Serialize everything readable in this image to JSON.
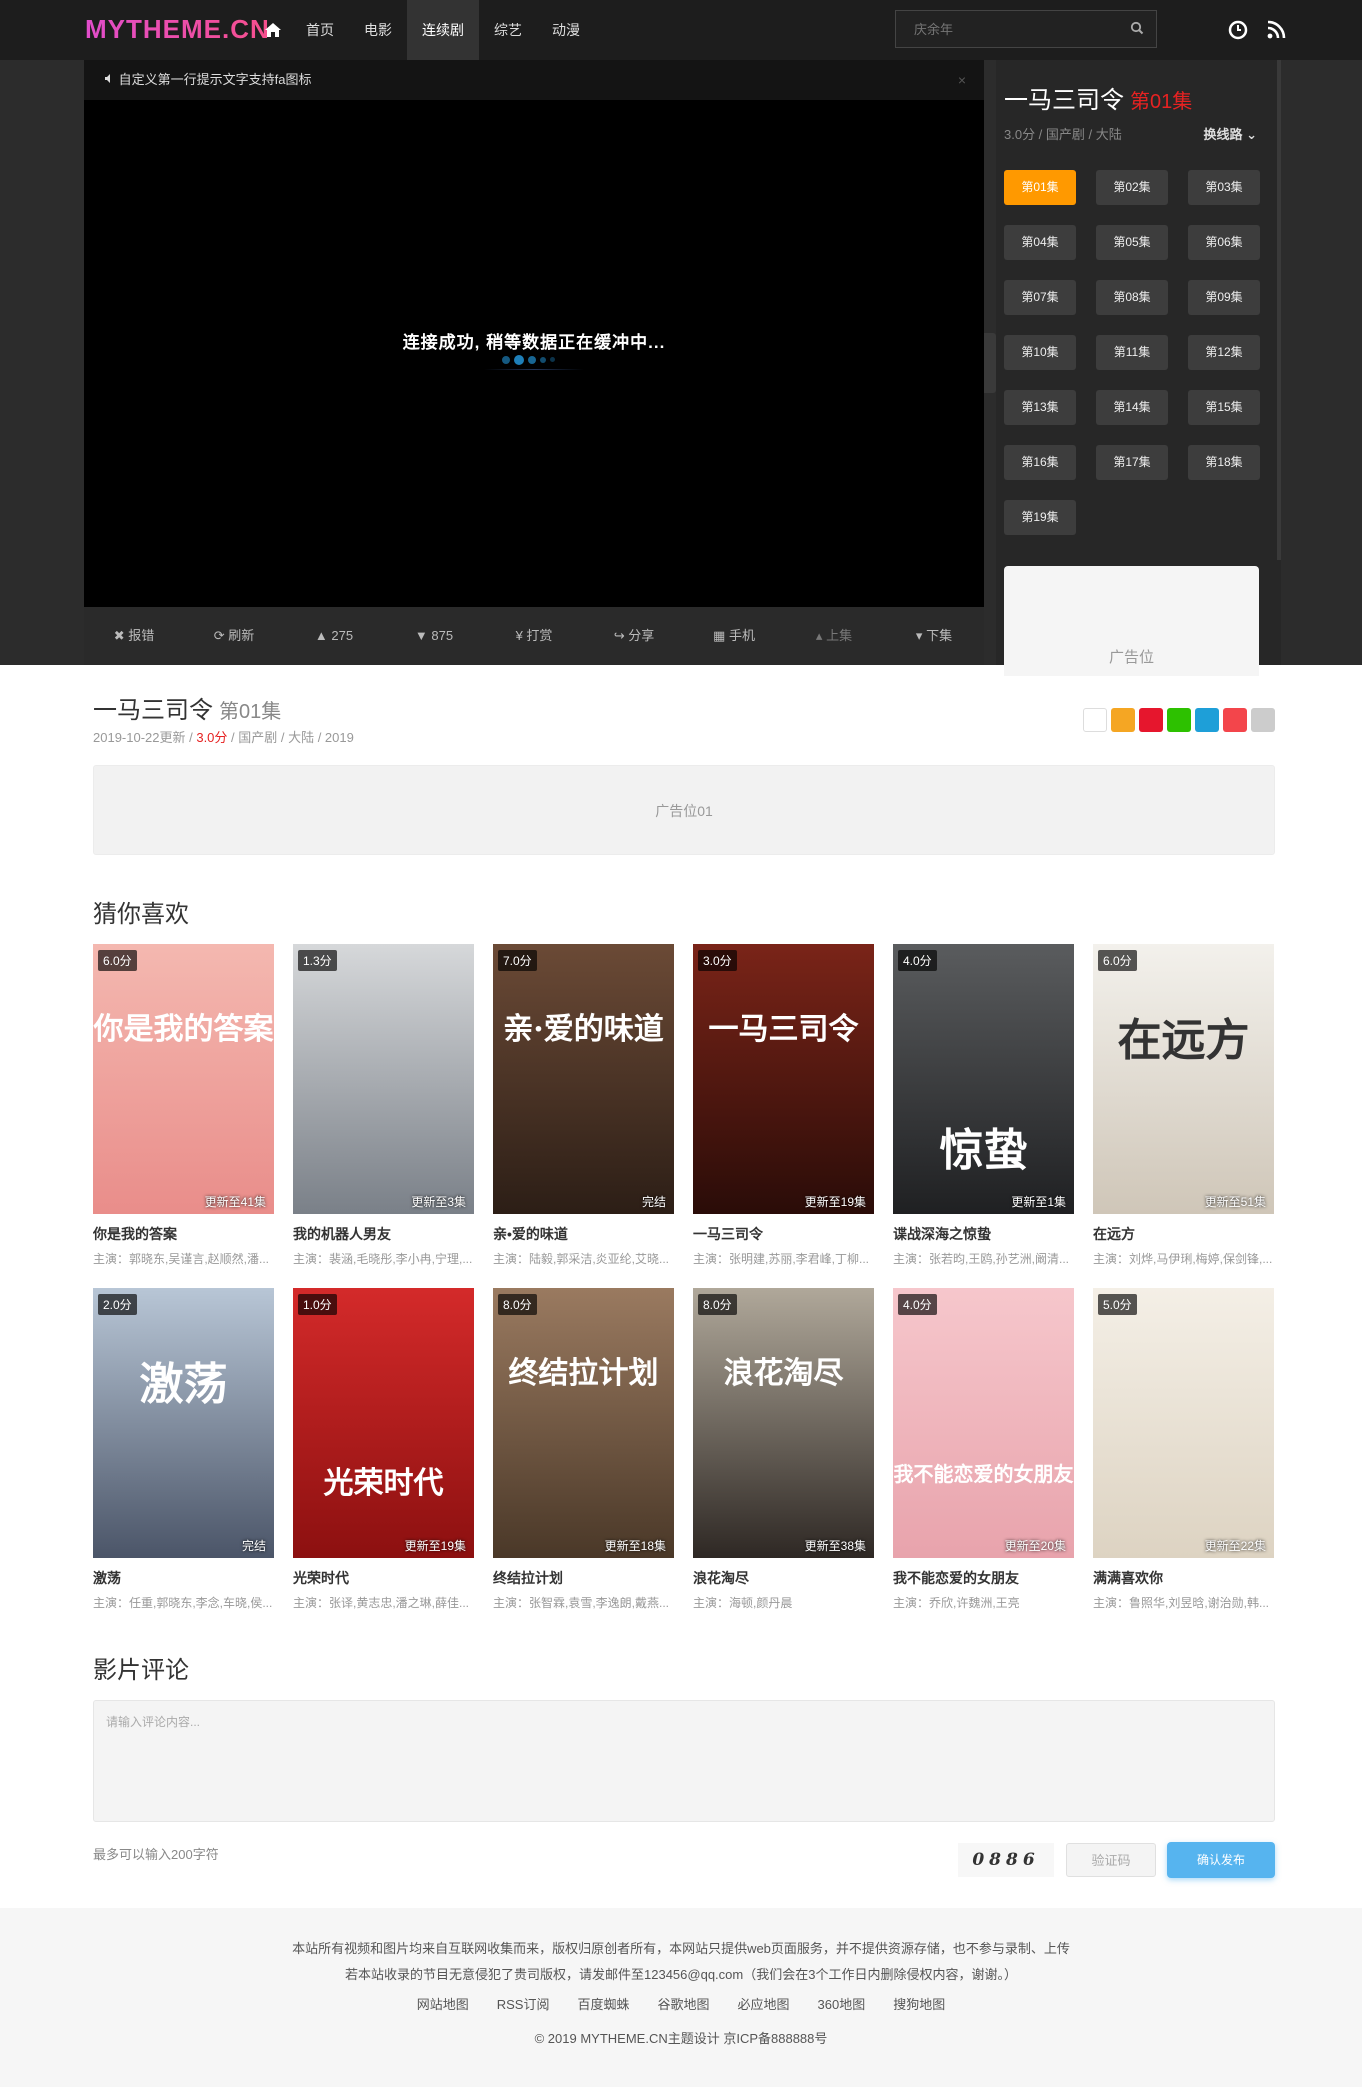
{
  "header": {
    "logo": "MYTHEME.CN",
    "nav": [
      "首页",
      "电影",
      "连续剧",
      "综艺",
      "动漫"
    ],
    "active_nav": "连续剧",
    "search_placeholder": "庆余年"
  },
  "player": {
    "tip": "自定义第一行提示文字支持fa图标",
    "close": "×",
    "loading_text": "连接成功, 稍等数据正在缓冲中...",
    "toolbar": [
      "报错",
      "刷新",
      "275",
      "875",
      "打赏",
      "分享",
      "手机",
      "上集",
      "下集"
    ]
  },
  "episodes": {
    "title": "一马三司令",
    "current": "第01集",
    "meta": "3.0分 / 国产剧 / 大陆",
    "switch_line": "换线路",
    "list": [
      "第01集",
      "第02集",
      "第03集",
      "第04集",
      "第05集",
      "第06集",
      "第07集",
      "第08集",
      "第09集",
      "第10集",
      "第11集",
      "第12集",
      "第13集",
      "第14集",
      "第15集",
      "第16集",
      "第17集",
      "第18集",
      "第19集"
    ],
    "ad": "广告位"
  },
  "info": {
    "title": "一马三司令",
    "episode": "第01集",
    "updated": "2019-10-22更新 / ",
    "score": "3.0分",
    "rest": " / 国产剧 / 大陆 / 2019",
    "ad": "广告位01"
  },
  "recommend": {
    "heading": "猜你喜欢",
    "items": [
      {
        "score": "6.0分",
        "update": "更新至41集",
        "name": "你是我的答案",
        "cast": "主演：郭晓东,吴谨言,赵顺然,潘...",
        "colors": [
          "#f4b8b0",
          "#e98d8a"
        ],
        "ptext": "你是我的答案"
      },
      {
        "score": "1.3分",
        "update": "更新至3集",
        "name": "我的机器人男友",
        "cast": "主演：裴涵,毛晓彤,李小冉,宁理,...",
        "colors": [
          "#d6d8da",
          "#7a8088"
        ],
        "ptext": ""
      },
      {
        "score": "7.0分",
        "update": "完结",
        "name": "亲•爱的味道",
        "cast": "主演：陆毅,郭采洁,炎亚纶,艾晓...",
        "colors": [
          "#6b4a36",
          "#2c1e16"
        ],
        "ptext": "亲·爱的味道"
      },
      {
        "score": "3.0分",
        "update": "更新至19集",
        "name": "一马三司令",
        "cast": "主演：张明建,苏丽,李君峰,丁柳...",
        "colors": [
          "#7a2418",
          "#2a0c08"
        ],
        "ptext": "一马三司令"
      },
      {
        "score": "4.0分",
        "update": "更新至1集",
        "name": "谍战深海之惊蛰",
        "cast": "主演：张若昀,王鸥,孙艺洲,阚清...",
        "colors": [
          "#5a5c5e",
          "#1f2022"
        ],
        "ptext": "惊蛰"
      },
      {
        "score": "6.0分",
        "update": "更新至51集",
        "name": "在远方",
        "cast": "主演：刘烨,马伊琍,梅婷,保剑锋,...",
        "colors": [
          "#f3f1ec",
          "#cfc6b8"
        ],
        "ptext": "在远方"
      },
      {
        "score": "2.0分",
        "update": "完结",
        "name": "激荡",
        "cast": "主演：任重,郭晓东,李念,车晓,侯...",
        "colors": [
          "#b8c6d6",
          "#4b5568"
        ],
        "ptext": "激荡"
      },
      {
        "score": "1.0分",
        "update": "更新至19集",
        "name": "光荣时代",
        "cast": "主演：张译,黄志忠,潘之琳,薛佳...",
        "colors": [
          "#d42a2a",
          "#8c1010"
        ],
        "ptext": "光荣时代"
      },
      {
        "score": "8.0分",
        "update": "更新至18集",
        "name": "终结拉计划",
        "cast": "主演：张智霖,袁雪,李逸朗,戴燕...",
        "colors": [
          "#9a7a60",
          "#4a3828"
        ],
        "ptext": "终结拉计划"
      },
      {
        "score": "8.0分",
        "update": "更新至38集",
        "name": "浪花淘尽",
        "cast": "主演：海顿,颜丹晨",
        "colors": [
          "#b0a89a",
          "#2e2824"
        ],
        "ptext": "浪花淘尽"
      },
      {
        "score": "4.0分",
        "update": "更新至20集",
        "name": "我不能恋爱的女朋友",
        "cast": "主演：乔欣,许魏洲,王亮",
        "colors": [
          "#f6c7cc",
          "#e8a3ac"
        ],
        "ptext": "我不能恋爱的女朋友"
      },
      {
        "score": "5.0分",
        "update": "更新至22集",
        "name": "满满喜欢你",
        "cast": "主演：鲁照华,刘昱晗,谢治勋,韩...",
        "colors": [
          "#f4efe6",
          "#ddd3c2"
        ],
        "ptext": ""
      }
    ]
  },
  "comment": {
    "heading": "影片评论",
    "placeholder": "请输入评论内容...",
    "limit": "最多可以输入200字符",
    "captcha": "0886",
    "verify_placeholder": "验证码",
    "submit": "确认发布"
  },
  "footer": {
    "line1": "本站所有视频和图片均来自互联网收集而来，版权归原创者所有，本网站只提供web页面服务，并不提供资源存储，也不参与录制、上传",
    "line2": "若本站收录的节目无意侵犯了贵司版权，请发邮件至123456@qq.com（我们会在3个工作日内删除侵权内容，谢谢。）",
    "links": [
      "网站地图",
      "RSS订阅",
      "百度蜘蛛",
      "谷歌地图",
      "必应地图",
      "360地图",
      "搜狗地图"
    ],
    "copyright": "© 2019 MYTHEME.CN主题设计 京ICP备888888号"
  },
  "colors": {
    "accent": "#ff9900",
    "red": "#e62222",
    "blue": "#56b4ef",
    "dark": "#1d1d1d"
  }
}
